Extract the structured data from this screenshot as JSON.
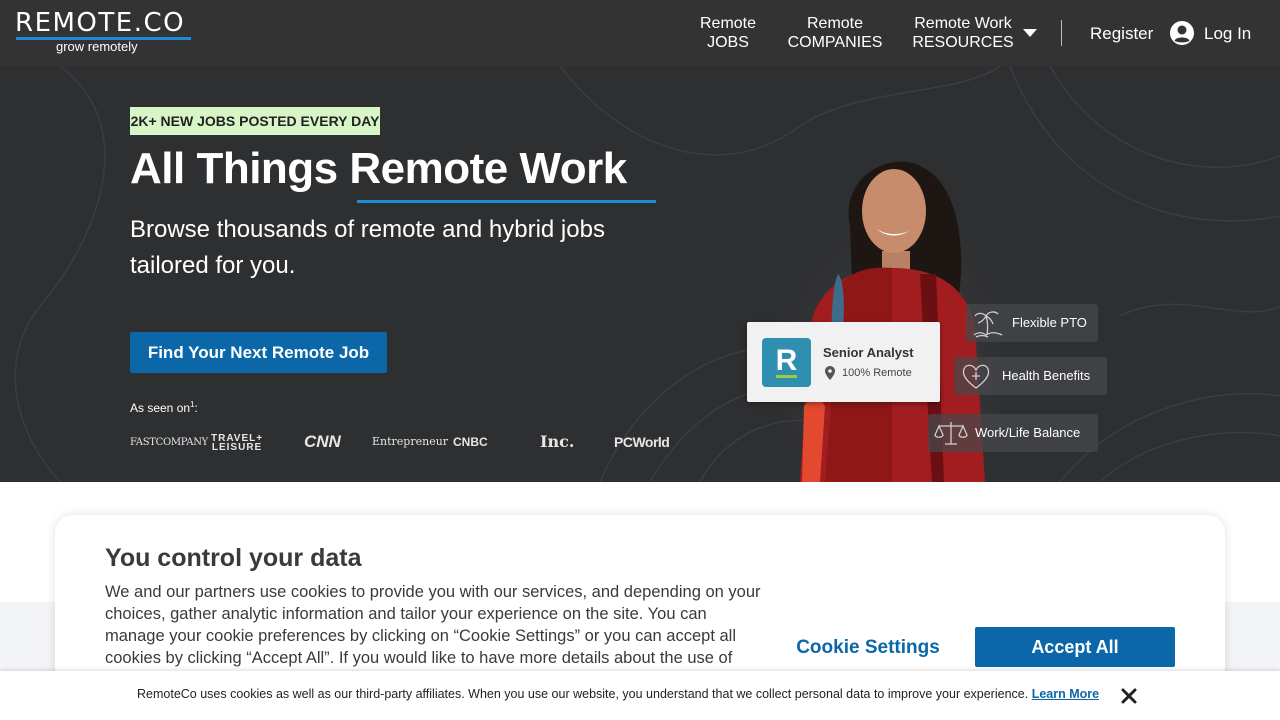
{
  "header": {
    "logo_text": "REMOTE.CO",
    "logo_tagline": "grow remotely",
    "nav": [
      {
        "line1": "Remote",
        "line2": "JOBS"
      },
      {
        "line1": "Remote",
        "line2": "COMPANIES"
      },
      {
        "line1": "Remote Work",
        "line2": "RESOURCES"
      }
    ],
    "register_label": "Register",
    "login_label": "Log In"
  },
  "hero": {
    "badge": "2K+ NEW JOBS POSTED EVERY DAY",
    "title": "All Things Remote Work",
    "subtitle": "Browse thousands of remote and hybrid jobs tailored for you.",
    "cta_label": "Find Your Next Remote Job",
    "as_seen_on": "As seen on",
    "as_seen_on_sup": "1",
    "as_seen_on_suffix": ":",
    "press_logos": [
      "FASTCOMPANY",
      "TRAVEL+",
      "LEISURE",
      "CNN",
      "Entrepreneur",
      "CNBC",
      "Inc.",
      "PCWorld"
    ],
    "job_card": {
      "logo_letter": "R",
      "title": "Senior Analyst",
      "location": "100% Remote"
    },
    "perks": [
      "Flexible PTO",
      "Health Benefits",
      "Work/Life Balance"
    ]
  },
  "cookie_modal": {
    "title": "You control your data",
    "body": "We and our partners use cookies to provide you with our services, and depending on your choices, gather analytic information and tailor your experience on the site. You can manage your cookie preferences by clicking on “Cookie Settings” or you can accept all cookies by clicking “Accept All”. If you would like to have more details about the use of",
    "settings_label": "Cookie Settings",
    "accept_label": "Accept All"
  },
  "cookie_bar": {
    "text": "RemoteCo uses cookies as well as our third-party affiliates. When you use our website, you understand that we collect personal data to improve your experience.",
    "link_label": "Learn More"
  },
  "colors": {
    "nav_bg": "#333333",
    "hero_bg": "#2e2f31",
    "accent_blue": "#1e8bd6",
    "button_blue": "#0b67a8",
    "badge_bg": "#d8f5c8"
  },
  "icons": [
    "chevron-down-icon",
    "user-icon",
    "map-pin-icon",
    "palm-tree-icon",
    "heart-icon",
    "scales-icon",
    "close-icon"
  ]
}
